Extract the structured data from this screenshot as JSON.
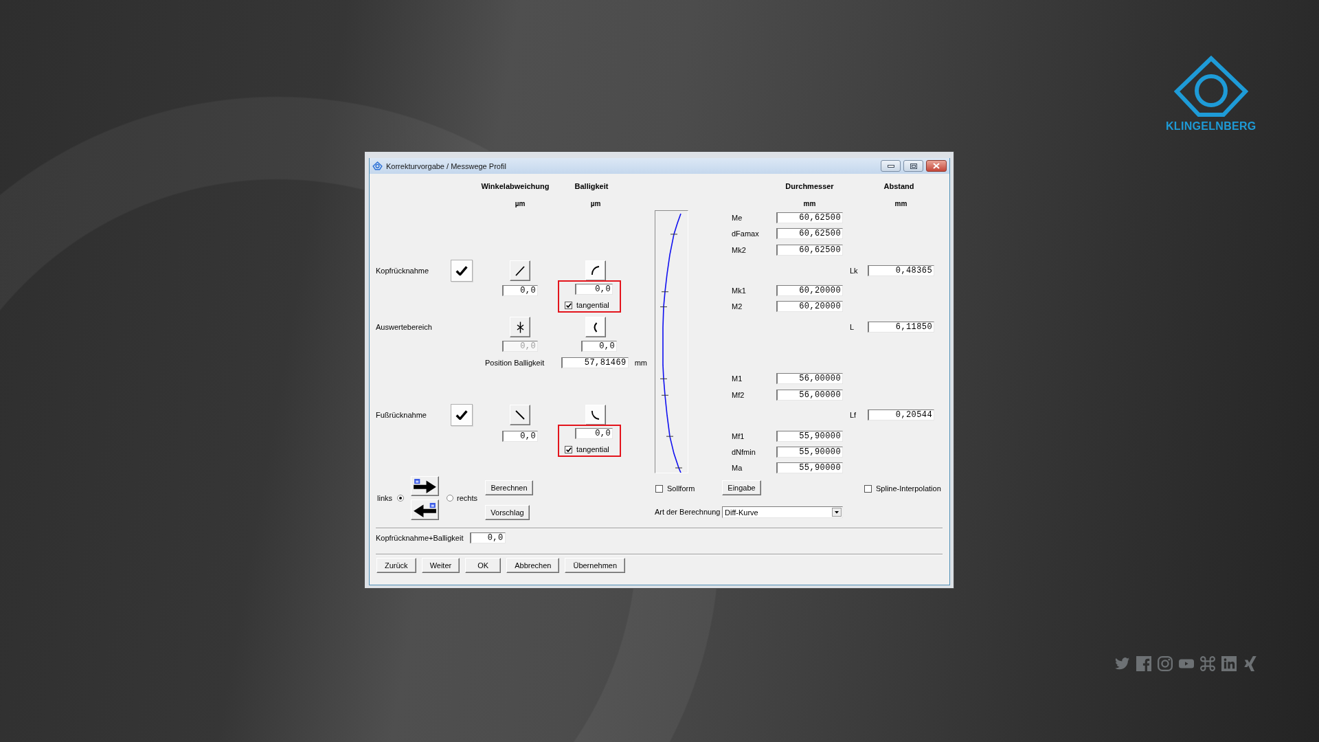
{
  "brand": {
    "name": "KLINGELNBERG"
  },
  "window": {
    "title": "Korrekturvorgabe / Messwege Profil"
  },
  "columns": [
    {
      "label": "Winkelabweichung",
      "unit": "µm"
    },
    {
      "label": "Balligkeit",
      "unit": "µm"
    },
    {
      "label": "Durchmesser",
      "unit": "mm"
    },
    {
      "label": "Abstand",
      "unit": "mm"
    }
  ],
  "kopfruecknahme": {
    "label": "Kopfrücknahme",
    "checked": true,
    "winkel": {
      "value": "0,0",
      "disabled": false
    },
    "balligkeit": {
      "value": "0,0",
      "disabled": false,
      "highlighted": true,
      "tangential": {
        "label": "tangential",
        "checked": true
      }
    }
  },
  "auswertebereich": {
    "label": "Auswertebereich",
    "winkel": {
      "value": "0,0",
      "disabled": true
    },
    "balligkeit": {
      "value": "0,0",
      "disabled": false,
      "highlighted": false
    },
    "position": {
      "label": "Position Balligkeit",
      "value": "57,81469",
      "unit": "mm"
    }
  },
  "fussruecknahme": {
    "label": "Fußrücknahme",
    "checked": true,
    "winkel": {
      "value": "0,0",
      "disabled": false
    },
    "balligkeit": {
      "value": "0,0",
      "disabled": false,
      "highlighted": true,
      "tangential": {
        "label": "tangential",
        "checked": true
      }
    }
  },
  "durchmesser": [
    {
      "label": "Me",
      "value": "60,62500"
    },
    {
      "label": "dFamax",
      "value": "60,62500"
    },
    {
      "label": "Mk2",
      "value": "60,62500"
    },
    {
      "label": "Mk1",
      "value": "60,20000"
    },
    {
      "label": "M2",
      "value": "60,20000"
    },
    {
      "label": "M1",
      "value": "56,00000"
    },
    {
      "label": "Mf2",
      "value": "56,00000"
    },
    {
      "label": "Mf1",
      "value": "55,90000"
    },
    {
      "label": "dNfmin",
      "value": "55,90000"
    },
    {
      "label": "Ma",
      "value": "55,90000"
    }
  ],
  "abstand": [
    {
      "label": "Lk",
      "value": "0,48365"
    },
    {
      "label": "L",
      "value": "6,11850"
    },
    {
      "label": "Lf",
      "value": "0,20544"
    }
  ],
  "side": [
    {
      "label": "links",
      "selected": true
    },
    {
      "label": "rechts",
      "selected": false
    }
  ],
  "actions": [
    {
      "label": "Berechnen"
    },
    {
      "label": "Vorschlag"
    }
  ],
  "sollform": {
    "label": "Sollform",
    "checked": false
  },
  "eingabe": {
    "label": "Eingabe"
  },
  "spline": {
    "label": "Spline-Interpolation",
    "checked": false
  },
  "berechnung": {
    "label": "Art der Berechnung",
    "value": "Diff-Kurve"
  },
  "summe": {
    "label": "Kopfrücknahme+Balligkeit",
    "value": "0,0"
  },
  "buttons": [
    {
      "label": "Zurück"
    },
    {
      "label": "Weiter"
    },
    {
      "label": "OK"
    },
    {
      "label": "Abbrechen"
    },
    {
      "label": "Übernehmen"
    }
  ]
}
